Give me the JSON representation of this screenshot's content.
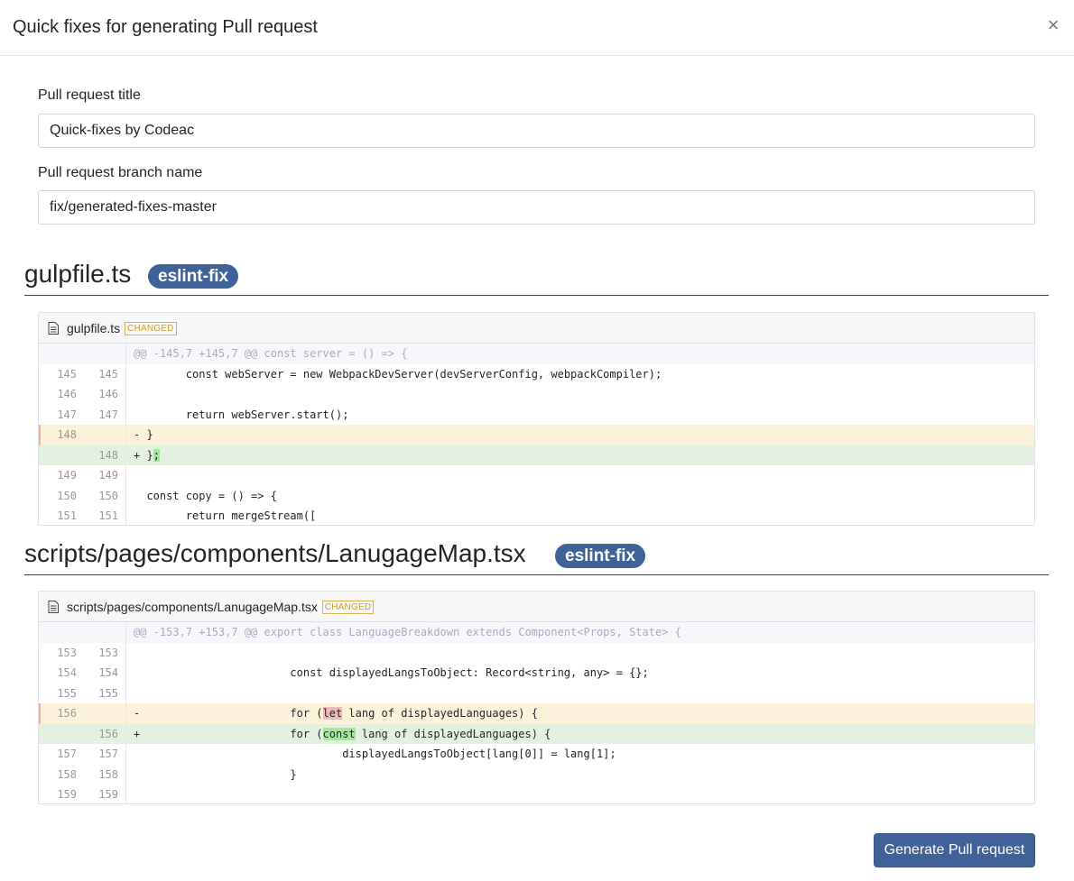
{
  "modal": {
    "title": "Quick fixes for generating Pull request",
    "close_label": "×"
  },
  "form": {
    "title_label": "Pull request title",
    "title_value": "Quick-fixes by Codeac",
    "branch_label": "Pull request branch name",
    "branch_value": "fix/generated-fixes-master"
  },
  "files": [
    {
      "name": "gulpfile.ts",
      "badge": "eslint-fix",
      "header_name": "gulpfile.ts",
      "changed_label": "CHANGED",
      "hunk": "@@ -145,7 +145,7 @@ const server = () => {",
      "lines": [
        {
          "old": "145",
          "new": "145",
          "type": "ctx",
          "pre": "        const webServer = new WebpackDevServer(devServerConfig, webpackCompiler);",
          "hl": "",
          "post": ""
        },
        {
          "old": "146",
          "new": "146",
          "type": "ctx",
          "pre": "",
          "hl": "",
          "post": ""
        },
        {
          "old": "147",
          "new": "147",
          "type": "ctx",
          "pre": "        return webServer.start();",
          "hl": "",
          "post": ""
        },
        {
          "old": "148",
          "new": "",
          "type": "del",
          "pre": "- }",
          "hl": "",
          "post": ""
        },
        {
          "old": "",
          "new": "148",
          "type": "add",
          "pre": "+ }",
          "hl": ";",
          "post": ""
        },
        {
          "old": "149",
          "new": "149",
          "type": "ctx",
          "pre": "",
          "hl": "",
          "post": ""
        },
        {
          "old": "150",
          "new": "150",
          "type": "ctx",
          "pre": "  const copy = () => {",
          "hl": "",
          "post": ""
        },
        {
          "old": "151",
          "new": "151",
          "type": "ctx",
          "pre": "        return mergeStream([",
          "hl": "",
          "post": ""
        }
      ]
    },
    {
      "name": "scripts/pages/components/LanugageMap.tsx",
      "badge": "eslint-fix",
      "header_name": "scripts/pages/components/LanugageMap.tsx",
      "changed_label": "CHANGED",
      "hunk": "@@ -153,7 +153,7 @@ export class LanguageBreakdown extends Component<Props, State> {",
      "lines": [
        {
          "old": "153",
          "new": "153",
          "type": "ctx",
          "pre": "",
          "hl": "",
          "post": ""
        },
        {
          "old": "154",
          "new": "154",
          "type": "ctx",
          "pre": "                        const displayedLangsToObject: Record<string, any> = {};",
          "hl": "",
          "post": ""
        },
        {
          "old": "155",
          "new": "155",
          "type": "ctx",
          "pre": "",
          "hl": "",
          "post": ""
        },
        {
          "old": "156",
          "new": "",
          "type": "del",
          "pre": "-                       for (",
          "hl": "let",
          "post": " lang of displayedLanguages) {"
        },
        {
          "old": "",
          "new": "156",
          "type": "add",
          "pre": "+                       for (",
          "hl": "const",
          "post": " lang of displayedLanguages) {"
        },
        {
          "old": "157",
          "new": "157",
          "type": "ctx",
          "pre": "                                displayedLangsToObject[lang[0]] = lang[1];",
          "hl": "",
          "post": ""
        },
        {
          "old": "158",
          "new": "158",
          "type": "ctx",
          "pre": "                        }",
          "hl": "",
          "post": ""
        },
        {
          "old": "159",
          "new": "159",
          "type": "ctx",
          "pre": "",
          "hl": "",
          "post": ""
        }
      ]
    }
  ],
  "footer": {
    "generate_label": "Generate Pull request"
  },
  "colors": {
    "primary": "#3f6398",
    "changed": "#c9a227",
    "del_bg": "#fcf2d9",
    "add_bg": "#e4f1e0"
  }
}
